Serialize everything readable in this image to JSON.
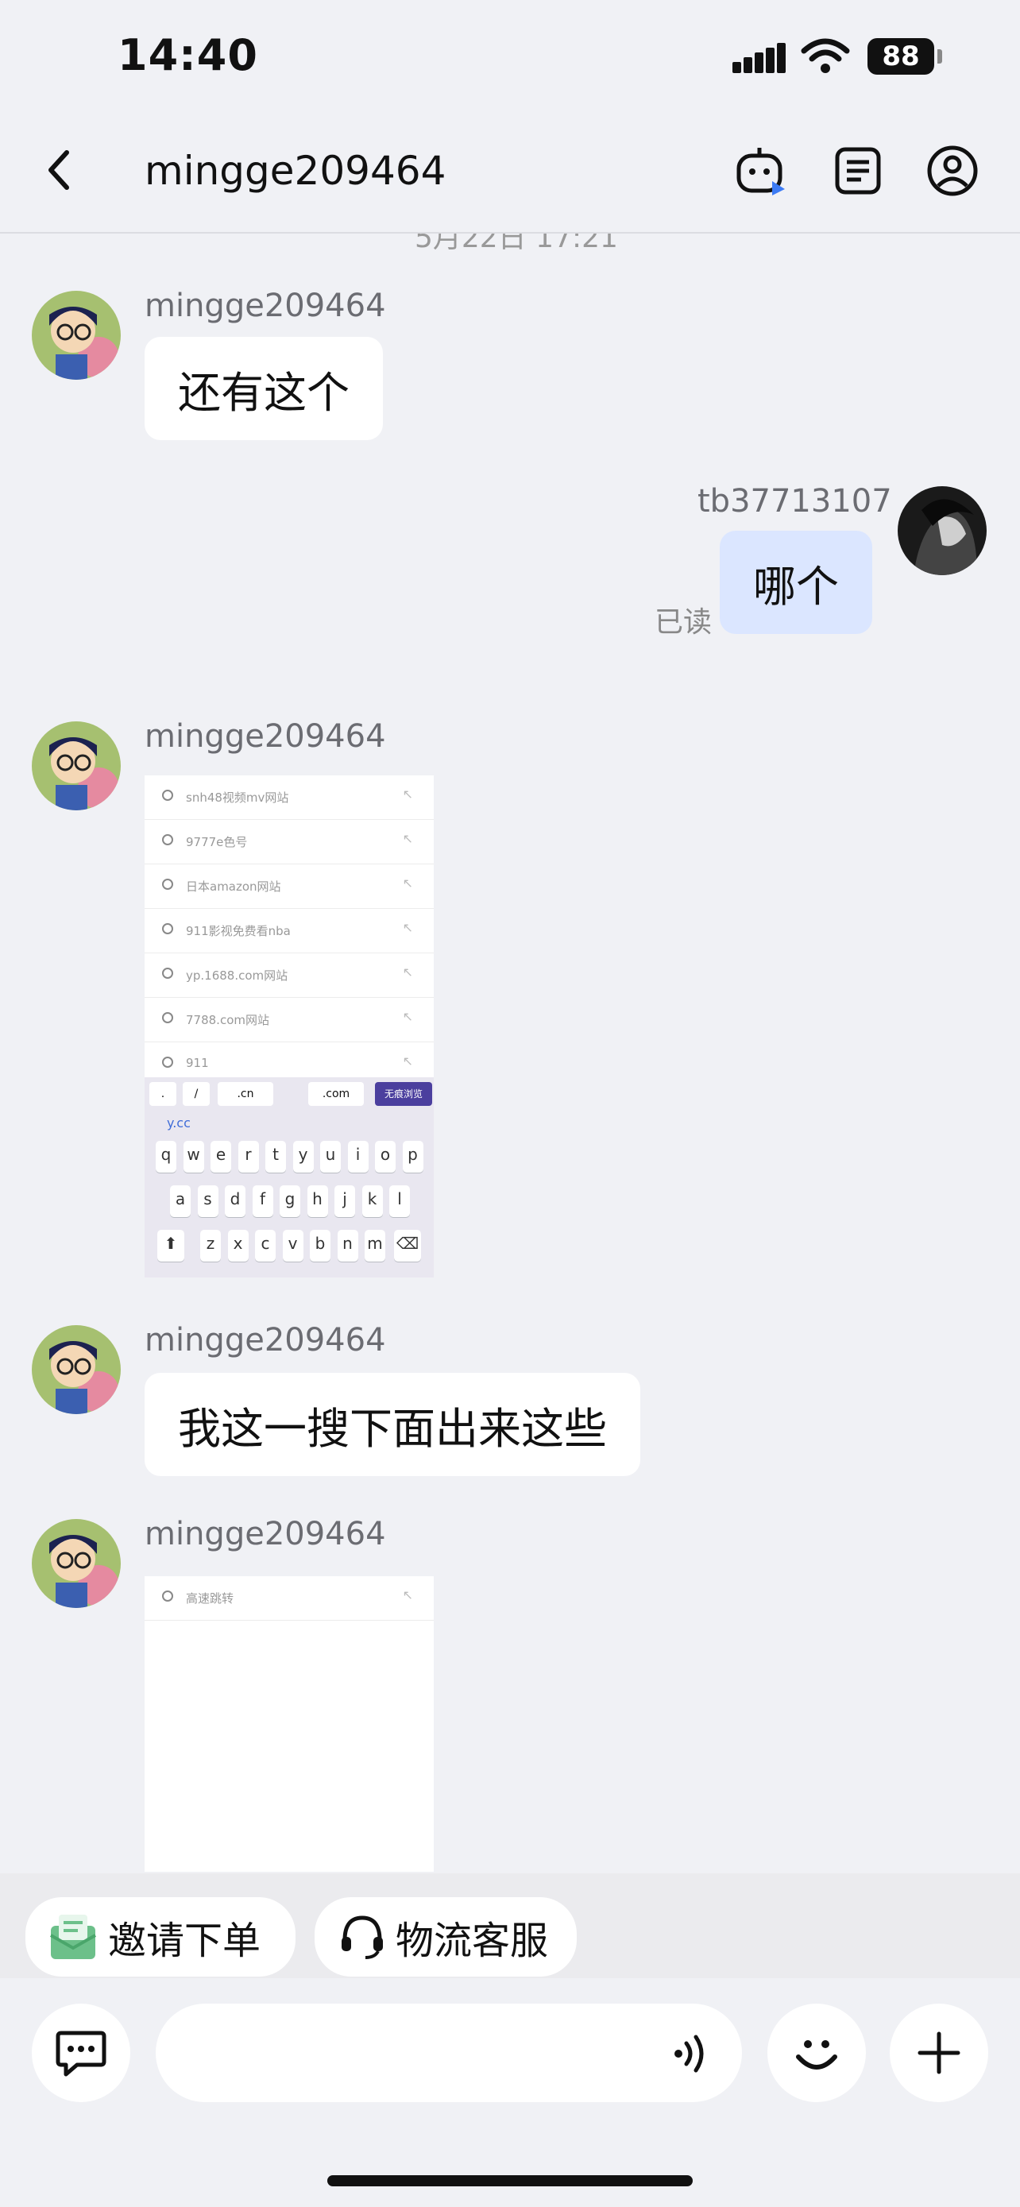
{
  "status_bar": {
    "time": "14:40",
    "battery": "88"
  },
  "header": {
    "title": "mingge209464"
  },
  "chat": {
    "timestamp_partial": "5月22日 17:21",
    "messages": [
      {
        "sender": "mingge209464",
        "text": "还有这个"
      },
      {
        "sender": "tb37713107",
        "text": "哪个",
        "read_status": "已读"
      },
      {
        "sender": "mingge209464",
        "type": "image"
      },
      {
        "sender": "mingge209464",
        "text": "我这一搜下面出来这些"
      },
      {
        "sender": "mingge209464",
        "type": "image"
      }
    ]
  },
  "screenshot1": {
    "results": [
      "snh48视频mv网站",
      "9777e色号",
      "日本amazon网站",
      "911影视免费看nba",
      "yp.1688.com网站",
      "7788.com网站",
      "911"
    ],
    "quick_keys": [
      ".",
      "/",
      ".cn",
      ".com"
    ],
    "browse_button": "无痕浏览",
    "suggestion": "y.cc",
    "row1": [
      "q",
      "w",
      "e",
      "r",
      "t",
      "y",
      "u",
      "i",
      "o",
      "p"
    ],
    "row2": [
      "a",
      "s",
      "d",
      "f",
      "g",
      "h",
      "j",
      "k",
      "l"
    ],
    "row3": [
      "z",
      "x",
      "c",
      "v",
      "b",
      "n",
      "m"
    ]
  },
  "screenshot2": {
    "results": [
      "高速跳转"
    ]
  },
  "quick_actions": [
    {
      "label": "邀请下单",
      "icon": "invite-order-icon"
    },
    {
      "label": "物流客服",
      "icon": "headset-icon"
    }
  ],
  "colors": {
    "background": "#f0f1f5",
    "self_bubble": "#dbe6ff",
    "accent": "#4b3f9e"
  }
}
